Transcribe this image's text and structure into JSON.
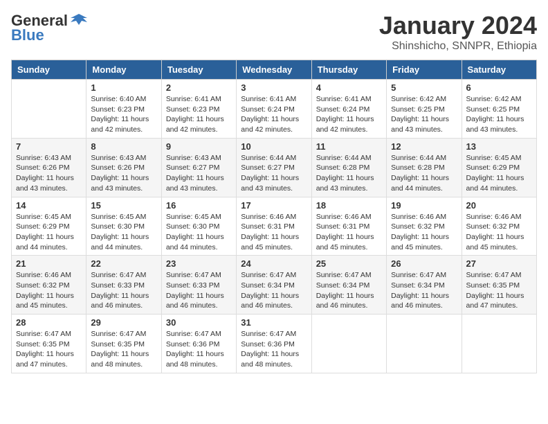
{
  "logo": {
    "general": "General",
    "blue": "Blue"
  },
  "header": {
    "month": "January 2024",
    "location": "Shinshicho, SNNPR, Ethiopia"
  },
  "weekdays": [
    "Sunday",
    "Monday",
    "Tuesday",
    "Wednesday",
    "Thursday",
    "Friday",
    "Saturday"
  ],
  "weeks": [
    [
      {
        "day": "",
        "info": ""
      },
      {
        "day": "1",
        "info": "Sunrise: 6:40 AM\nSunset: 6:23 PM\nDaylight: 11 hours\nand 42 minutes."
      },
      {
        "day": "2",
        "info": "Sunrise: 6:41 AM\nSunset: 6:23 PM\nDaylight: 11 hours\nand 42 minutes."
      },
      {
        "day": "3",
        "info": "Sunrise: 6:41 AM\nSunset: 6:24 PM\nDaylight: 11 hours\nand 42 minutes."
      },
      {
        "day": "4",
        "info": "Sunrise: 6:41 AM\nSunset: 6:24 PM\nDaylight: 11 hours\nand 42 minutes."
      },
      {
        "day": "5",
        "info": "Sunrise: 6:42 AM\nSunset: 6:25 PM\nDaylight: 11 hours\nand 43 minutes."
      },
      {
        "day": "6",
        "info": "Sunrise: 6:42 AM\nSunset: 6:25 PM\nDaylight: 11 hours\nand 43 minutes."
      }
    ],
    [
      {
        "day": "7",
        "info": "Sunrise: 6:43 AM\nSunset: 6:26 PM\nDaylight: 11 hours\nand 43 minutes."
      },
      {
        "day": "8",
        "info": "Sunrise: 6:43 AM\nSunset: 6:26 PM\nDaylight: 11 hours\nand 43 minutes."
      },
      {
        "day": "9",
        "info": "Sunrise: 6:43 AM\nSunset: 6:27 PM\nDaylight: 11 hours\nand 43 minutes."
      },
      {
        "day": "10",
        "info": "Sunrise: 6:44 AM\nSunset: 6:27 PM\nDaylight: 11 hours\nand 43 minutes."
      },
      {
        "day": "11",
        "info": "Sunrise: 6:44 AM\nSunset: 6:28 PM\nDaylight: 11 hours\nand 43 minutes."
      },
      {
        "day": "12",
        "info": "Sunrise: 6:44 AM\nSunset: 6:28 PM\nDaylight: 11 hours\nand 44 minutes."
      },
      {
        "day": "13",
        "info": "Sunrise: 6:45 AM\nSunset: 6:29 PM\nDaylight: 11 hours\nand 44 minutes."
      }
    ],
    [
      {
        "day": "14",
        "info": "Sunrise: 6:45 AM\nSunset: 6:29 PM\nDaylight: 11 hours\nand 44 minutes."
      },
      {
        "day": "15",
        "info": "Sunrise: 6:45 AM\nSunset: 6:30 PM\nDaylight: 11 hours\nand 44 minutes."
      },
      {
        "day": "16",
        "info": "Sunrise: 6:45 AM\nSunset: 6:30 PM\nDaylight: 11 hours\nand 44 minutes."
      },
      {
        "day": "17",
        "info": "Sunrise: 6:46 AM\nSunset: 6:31 PM\nDaylight: 11 hours\nand 45 minutes."
      },
      {
        "day": "18",
        "info": "Sunrise: 6:46 AM\nSunset: 6:31 PM\nDaylight: 11 hours\nand 45 minutes."
      },
      {
        "day": "19",
        "info": "Sunrise: 6:46 AM\nSunset: 6:32 PM\nDaylight: 11 hours\nand 45 minutes."
      },
      {
        "day": "20",
        "info": "Sunrise: 6:46 AM\nSunset: 6:32 PM\nDaylight: 11 hours\nand 45 minutes."
      }
    ],
    [
      {
        "day": "21",
        "info": "Sunrise: 6:46 AM\nSunset: 6:32 PM\nDaylight: 11 hours\nand 45 minutes."
      },
      {
        "day": "22",
        "info": "Sunrise: 6:47 AM\nSunset: 6:33 PM\nDaylight: 11 hours\nand 46 minutes."
      },
      {
        "day": "23",
        "info": "Sunrise: 6:47 AM\nSunset: 6:33 PM\nDaylight: 11 hours\nand 46 minutes."
      },
      {
        "day": "24",
        "info": "Sunrise: 6:47 AM\nSunset: 6:34 PM\nDaylight: 11 hours\nand 46 minutes."
      },
      {
        "day": "25",
        "info": "Sunrise: 6:47 AM\nSunset: 6:34 PM\nDaylight: 11 hours\nand 46 minutes."
      },
      {
        "day": "26",
        "info": "Sunrise: 6:47 AM\nSunset: 6:34 PM\nDaylight: 11 hours\nand 46 minutes."
      },
      {
        "day": "27",
        "info": "Sunrise: 6:47 AM\nSunset: 6:35 PM\nDaylight: 11 hours\nand 47 minutes."
      }
    ],
    [
      {
        "day": "28",
        "info": "Sunrise: 6:47 AM\nSunset: 6:35 PM\nDaylight: 11 hours\nand 47 minutes."
      },
      {
        "day": "29",
        "info": "Sunrise: 6:47 AM\nSunset: 6:35 PM\nDaylight: 11 hours\nand 48 minutes."
      },
      {
        "day": "30",
        "info": "Sunrise: 6:47 AM\nSunset: 6:36 PM\nDaylight: 11 hours\nand 48 minutes."
      },
      {
        "day": "31",
        "info": "Sunrise: 6:47 AM\nSunset: 6:36 PM\nDaylight: 11 hours\nand 48 minutes."
      },
      {
        "day": "",
        "info": ""
      },
      {
        "day": "",
        "info": ""
      },
      {
        "day": "",
        "info": ""
      }
    ]
  ]
}
